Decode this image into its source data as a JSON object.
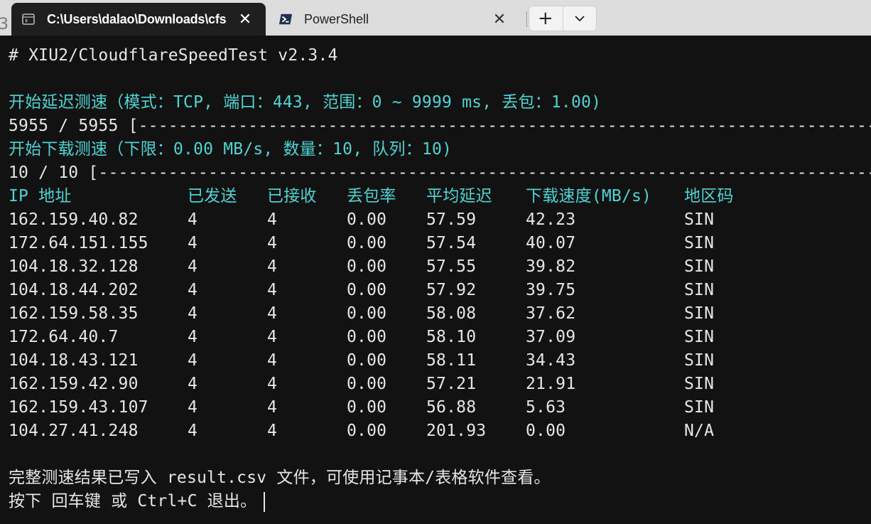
{
  "tabs": [
    {
      "title": "C:\\Users\\dalao\\Downloads\\cfs",
      "icon": "console-icon",
      "active": true
    },
    {
      "title": "PowerShell",
      "icon": "powershell-icon",
      "active": false
    }
  ],
  "tab_controls": {
    "new_tab": "+",
    "dropdown": "⌄",
    "close": "✕"
  },
  "terminal": {
    "header": "# XIU2/CloudflareSpeedTest v2.3.4",
    "latency_title": "开始延迟测速（模式：TCP, 端口：443, 范围：0 ~ 9999 ms, 丢包：1.00)",
    "latency_progress": "5955 / 5955 [---------------------------------------------------------------------------------------------------",
    "download_title": "开始下载测速（下限：0.00 MB/s, 数量：10, 队列：10)",
    "download_progress": "10 / 10 [-------------------------------------------------------------------------------------------------------",
    "table": {
      "headers": [
        "IP 地址",
        "已发送",
        "已接收",
        "丢包率",
        "平均延迟",
        "下载速度(MB/s)",
        "地区码"
      ],
      "rows": [
        [
          "162.159.40.82",
          "4",
          "4",
          "0.00",
          "57.59",
          "42.23",
          "SIN"
        ],
        [
          "172.64.151.155",
          "4",
          "4",
          "0.00",
          "57.54",
          "40.07",
          "SIN"
        ],
        [
          "104.18.32.128",
          "4",
          "4",
          "0.00",
          "57.55",
          "39.82",
          "SIN"
        ],
        [
          "104.18.44.202",
          "4",
          "4",
          "0.00",
          "57.92",
          "39.75",
          "SIN"
        ],
        [
          "162.159.58.35",
          "4",
          "4",
          "0.00",
          "58.08",
          "37.62",
          "SIN"
        ],
        [
          "172.64.40.7",
          "4",
          "4",
          "0.00",
          "58.10",
          "37.09",
          "SIN"
        ],
        [
          "104.18.43.121",
          "4",
          "4",
          "0.00",
          "58.11",
          "34.43",
          "SIN"
        ],
        [
          "162.159.42.90",
          "4",
          "4",
          "0.00",
          "57.21",
          "21.91",
          "SIN"
        ],
        [
          "162.159.43.107",
          "4",
          "4",
          "0.00",
          "56.88",
          "5.63",
          "SIN"
        ],
        [
          "104.27.41.248",
          "4",
          "4",
          "0.00",
          "201.93",
          "0.00",
          "N/A"
        ]
      ]
    },
    "footer_saved": "完整测速结果已写入 result.csv 文件，可使用记事本/表格软件查看。",
    "footer_exit": "按下 回车键 或 Ctrl+C 退出。"
  },
  "colors": {
    "accent_text": "#4fd3d3",
    "default_text": "#e6e6e6",
    "background": "#121212"
  }
}
